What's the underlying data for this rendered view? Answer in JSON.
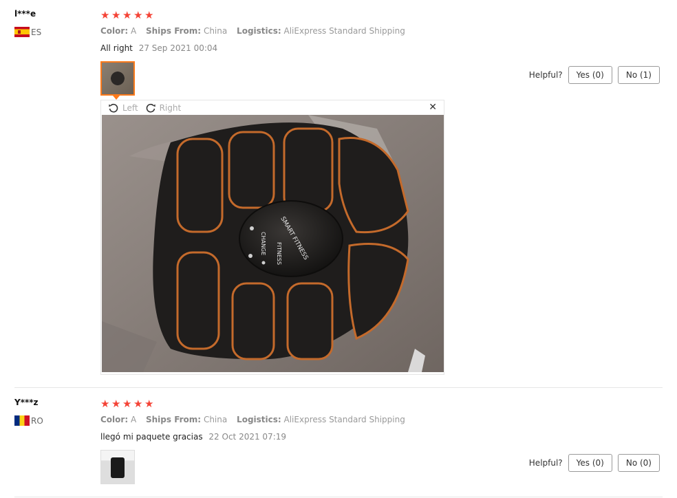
{
  "reviews": [
    {
      "user": "l***e",
      "country": "ES",
      "rating": 5,
      "meta": {
        "color_label": "Color:",
        "color_value": "A",
        "ships_label": "Ships From:",
        "ships_value": "China",
        "logistics_label": "Logistics:",
        "logistics_value": "AliExpress Standard Shipping"
      },
      "text": "All right",
      "date": "27 Sep 2021 00:04",
      "helpful": {
        "label": "Helpful?",
        "yes": "Yes (0)",
        "no": "No (1)"
      }
    },
    {
      "user": "Y***z",
      "country": "RO",
      "rating": 5,
      "meta": {
        "color_label": "Color:",
        "color_value": "A",
        "ships_label": "Ships From:",
        "ships_value": "China",
        "logistics_label": "Logistics:",
        "logistics_value": "AliExpress Standard Shipping"
      },
      "text": "llegó mi paquete gracias",
      "date": "22 Oct 2021 07:19",
      "helpful": {
        "label": "Helpful?",
        "yes": "Yes (0)",
        "no": "No (0)"
      }
    }
  ],
  "viewer": {
    "rotate_left": "Left",
    "rotate_right": "Right",
    "close_icon": "close-icon",
    "device_labels": [
      "SMART FITNESS",
      "CHANGE",
      "FITNESS"
    ]
  },
  "colors": {
    "star": "#f44336",
    "active_border": "#ff7a1a",
    "pad_black": "#1f1d1c",
    "pad_outline": "#c46a2b"
  }
}
